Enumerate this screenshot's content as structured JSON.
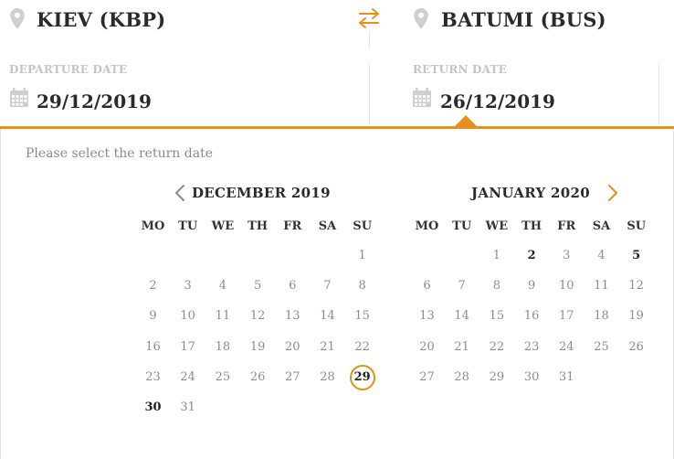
{
  "route": {
    "from": "KIEV (KBP)",
    "to": "BATUMI (BUS)",
    "icons": {
      "from": "map-pin-icon",
      "to": "map-pin-icon",
      "swap": "swap-arrows-icon"
    }
  },
  "departure": {
    "label": "DEPARTURE DATE",
    "value": "29/12/2019",
    "icon": "calendar-icon"
  },
  "return": {
    "label": "RETURN DATE",
    "value": "26/12/2019",
    "icon": "calendar-icon"
  },
  "picker": {
    "hint": "Please select the return date",
    "weekdays": [
      "MO",
      "TU",
      "WE",
      "TH",
      "FR",
      "SA",
      "SU"
    ],
    "accent_color": "#e58f1c",
    "months": [
      {
        "title": "DECEMBER 2019",
        "nav": "prev-month",
        "weeks": [
          [
            "",
            "",
            "",
            "",
            "",
            "",
            "1"
          ],
          [
            "2",
            "3",
            "4",
            "5",
            "6",
            "7",
            "8"
          ],
          [
            "9",
            "10",
            "11",
            "12",
            "13",
            "14",
            "15"
          ],
          [
            "16",
            "17",
            "18",
            "19",
            "20",
            "21",
            "22"
          ],
          [
            "23",
            "24",
            "25",
            "26",
            "27",
            "28",
            "29"
          ],
          [
            "30",
            "31",
            "",
            "",
            "",
            "",
            ""
          ]
        ],
        "selected": "29",
        "bold": [
          "30"
        ]
      },
      {
        "title": "JANUARY 2020",
        "nav": "next-month",
        "weeks": [
          [
            "",
            "",
            "1",
            "2",
            "3",
            "4",
            "5"
          ],
          [
            "6",
            "7",
            "8",
            "9",
            "10",
            "11",
            "12"
          ],
          [
            "13",
            "14",
            "15",
            "16",
            "17",
            "18",
            "19"
          ],
          [
            "20",
            "21",
            "22",
            "23",
            "24",
            "25",
            "26"
          ],
          [
            "27",
            "28",
            "29",
            "30",
            "31",
            "",
            ""
          ]
        ],
        "selected": "",
        "bold": [
          "2",
          "5"
        ]
      }
    ]
  }
}
